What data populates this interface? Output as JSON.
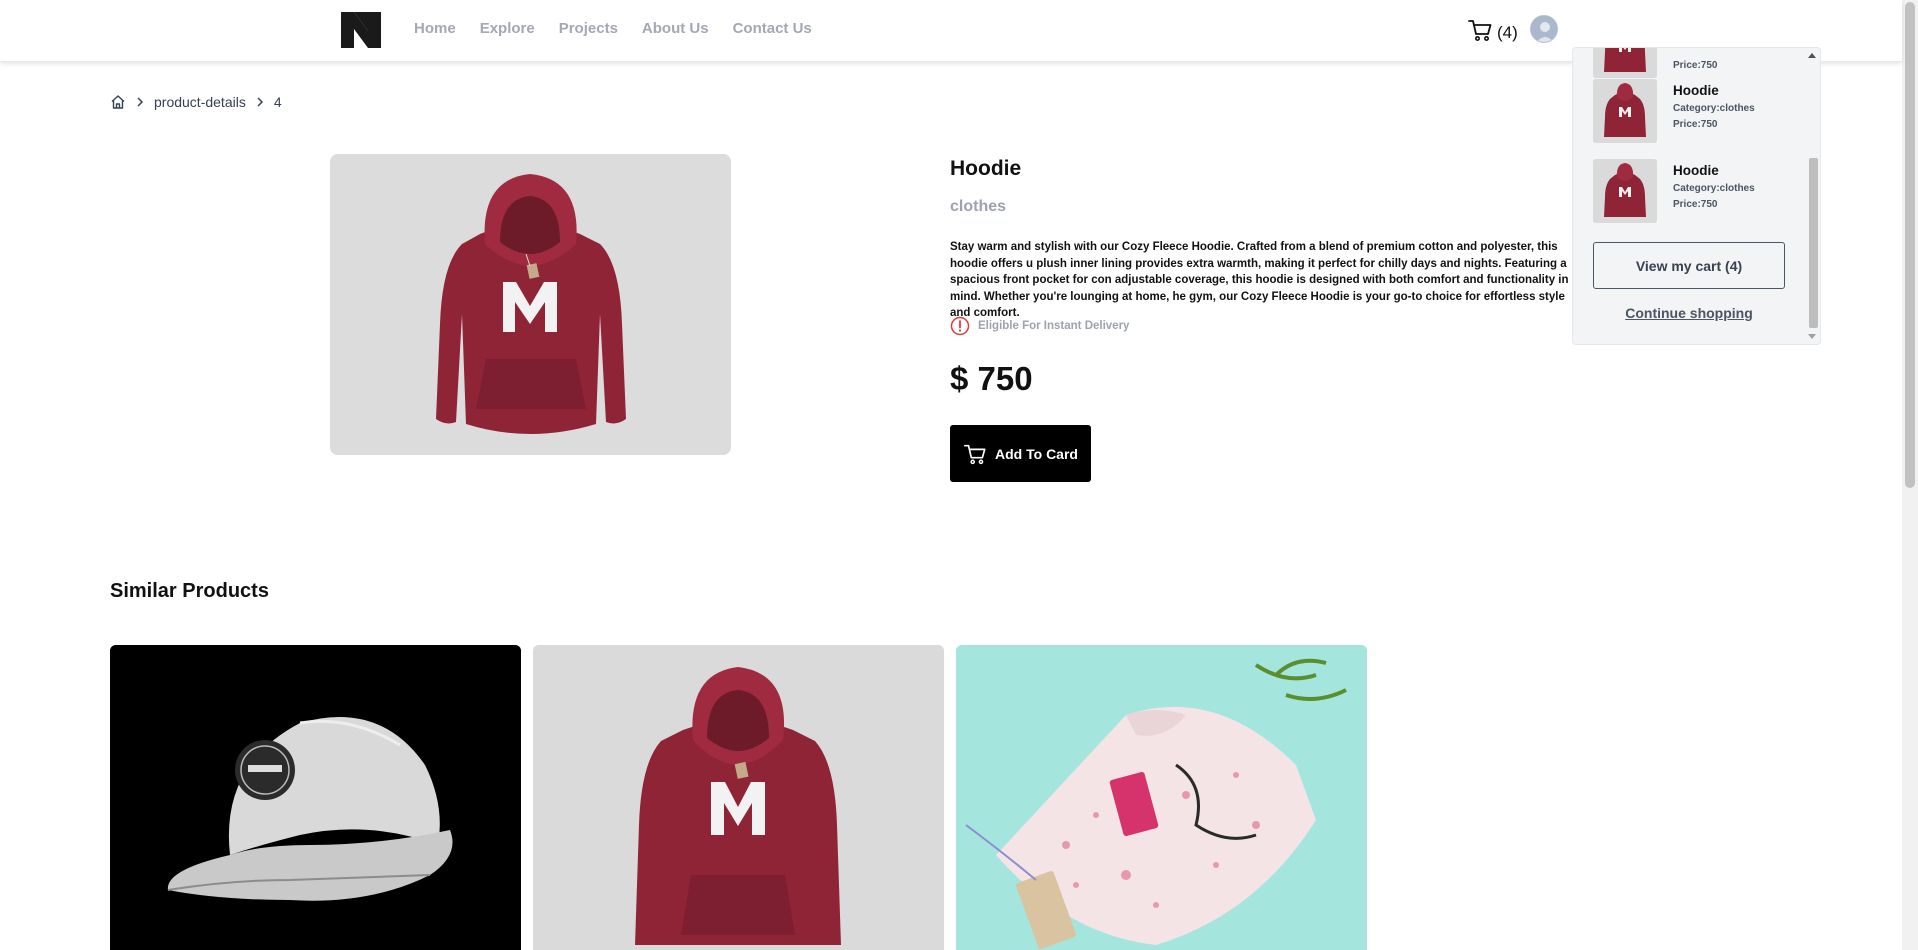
{
  "header": {
    "logo": "N",
    "nav": [
      {
        "label": "Home"
      },
      {
        "label": "Explore"
      },
      {
        "label": "Projects"
      },
      {
        "label": "About Us"
      },
      {
        "label": "Contact Us"
      }
    ],
    "cart_count_label": "(4)",
    "cart_icon": "cart-icon",
    "avatar_icon": "user-avatar"
  },
  "breadcrumb": {
    "home_icon": "home-icon",
    "items": [
      "product-details",
      "4"
    ]
  },
  "product": {
    "title": "Hoodie",
    "category": "clothes",
    "description": "Stay warm and stylish with our Cozy Fleece Hoodie. Crafted from a blend of premium cotton and polyester, this hoodie offers u plush inner lining provides extra warmth, making it perfect for chilly days and nights. Featuring a spacious front pocket for con adjustable coverage, this hoodie is designed with both comfort and functionality in mind. Whether you're lounging at home, he gym, our Cozy Fleece Hoodie is your go-to choice for effortless style and comfort.",
    "delivery_note": "Eligible For Instant Delivery",
    "price": "$ 750",
    "add_button_label": "Add To Card",
    "image": "red hoodie with letter M"
  },
  "similar": {
    "heading": "Similar Products",
    "items": [
      {
        "image": "white cap mockup on black"
      },
      {
        "image": "red hoodie with letter M"
      },
      {
        "image": "folded floral t-shirt with tag"
      }
    ]
  },
  "cart_dropdown": {
    "partial_item": {
      "price": "Price:750"
    },
    "items": [
      {
        "name": "Hoodie",
        "category": "Category:clothes",
        "price": "Price:750"
      },
      {
        "name": "Hoodie",
        "category": "Category:clothes",
        "price": "Price:750"
      }
    ],
    "view_cart_label": "View my cart (4)",
    "continue_label": "Continue shopping"
  },
  "colors": {
    "brand": "#1a1a1a",
    "nav_text": "#a3a8b3",
    "hoodie_red": "#8f2437",
    "button_bg": "#000000"
  }
}
